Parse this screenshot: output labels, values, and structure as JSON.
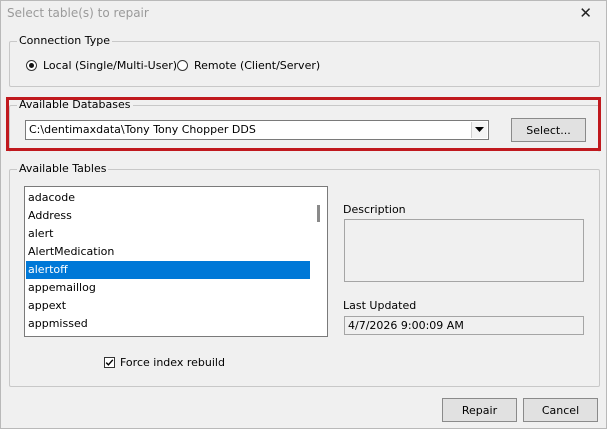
{
  "dialog": {
    "title": "Select table(s) to repair",
    "close_glyph": "✕"
  },
  "connection": {
    "legend": "Connection Type",
    "local_label": "Local (Single/Multi-User)",
    "remote_label": "Remote (Client/Server)",
    "selected": "local"
  },
  "databases": {
    "legend": "Available Databases",
    "selected_value": "C:\\dentimaxdata\\Tony Tony Chopper DDS",
    "select_button_label": "Select..."
  },
  "tables": {
    "legend": "Available Tables",
    "items": [
      "adacode",
      "Address",
      "alert",
      "AlertMedication",
      "alertoff",
      "appemaillog",
      "appext",
      "appmissed"
    ],
    "selected_index": 4,
    "description_label": "Description",
    "description_value": "",
    "last_updated_label": "Last Updated",
    "last_updated_value": "4/7/2026 9:00:09 AM",
    "force_rebuild_label": "Force index rebuild",
    "force_rebuild_checked": true
  },
  "buttons": {
    "repair_label": "Repair",
    "cancel_label": "Cancel"
  },
  "colors": {
    "highlight": "#c0191e",
    "selection": "#0078d7"
  }
}
